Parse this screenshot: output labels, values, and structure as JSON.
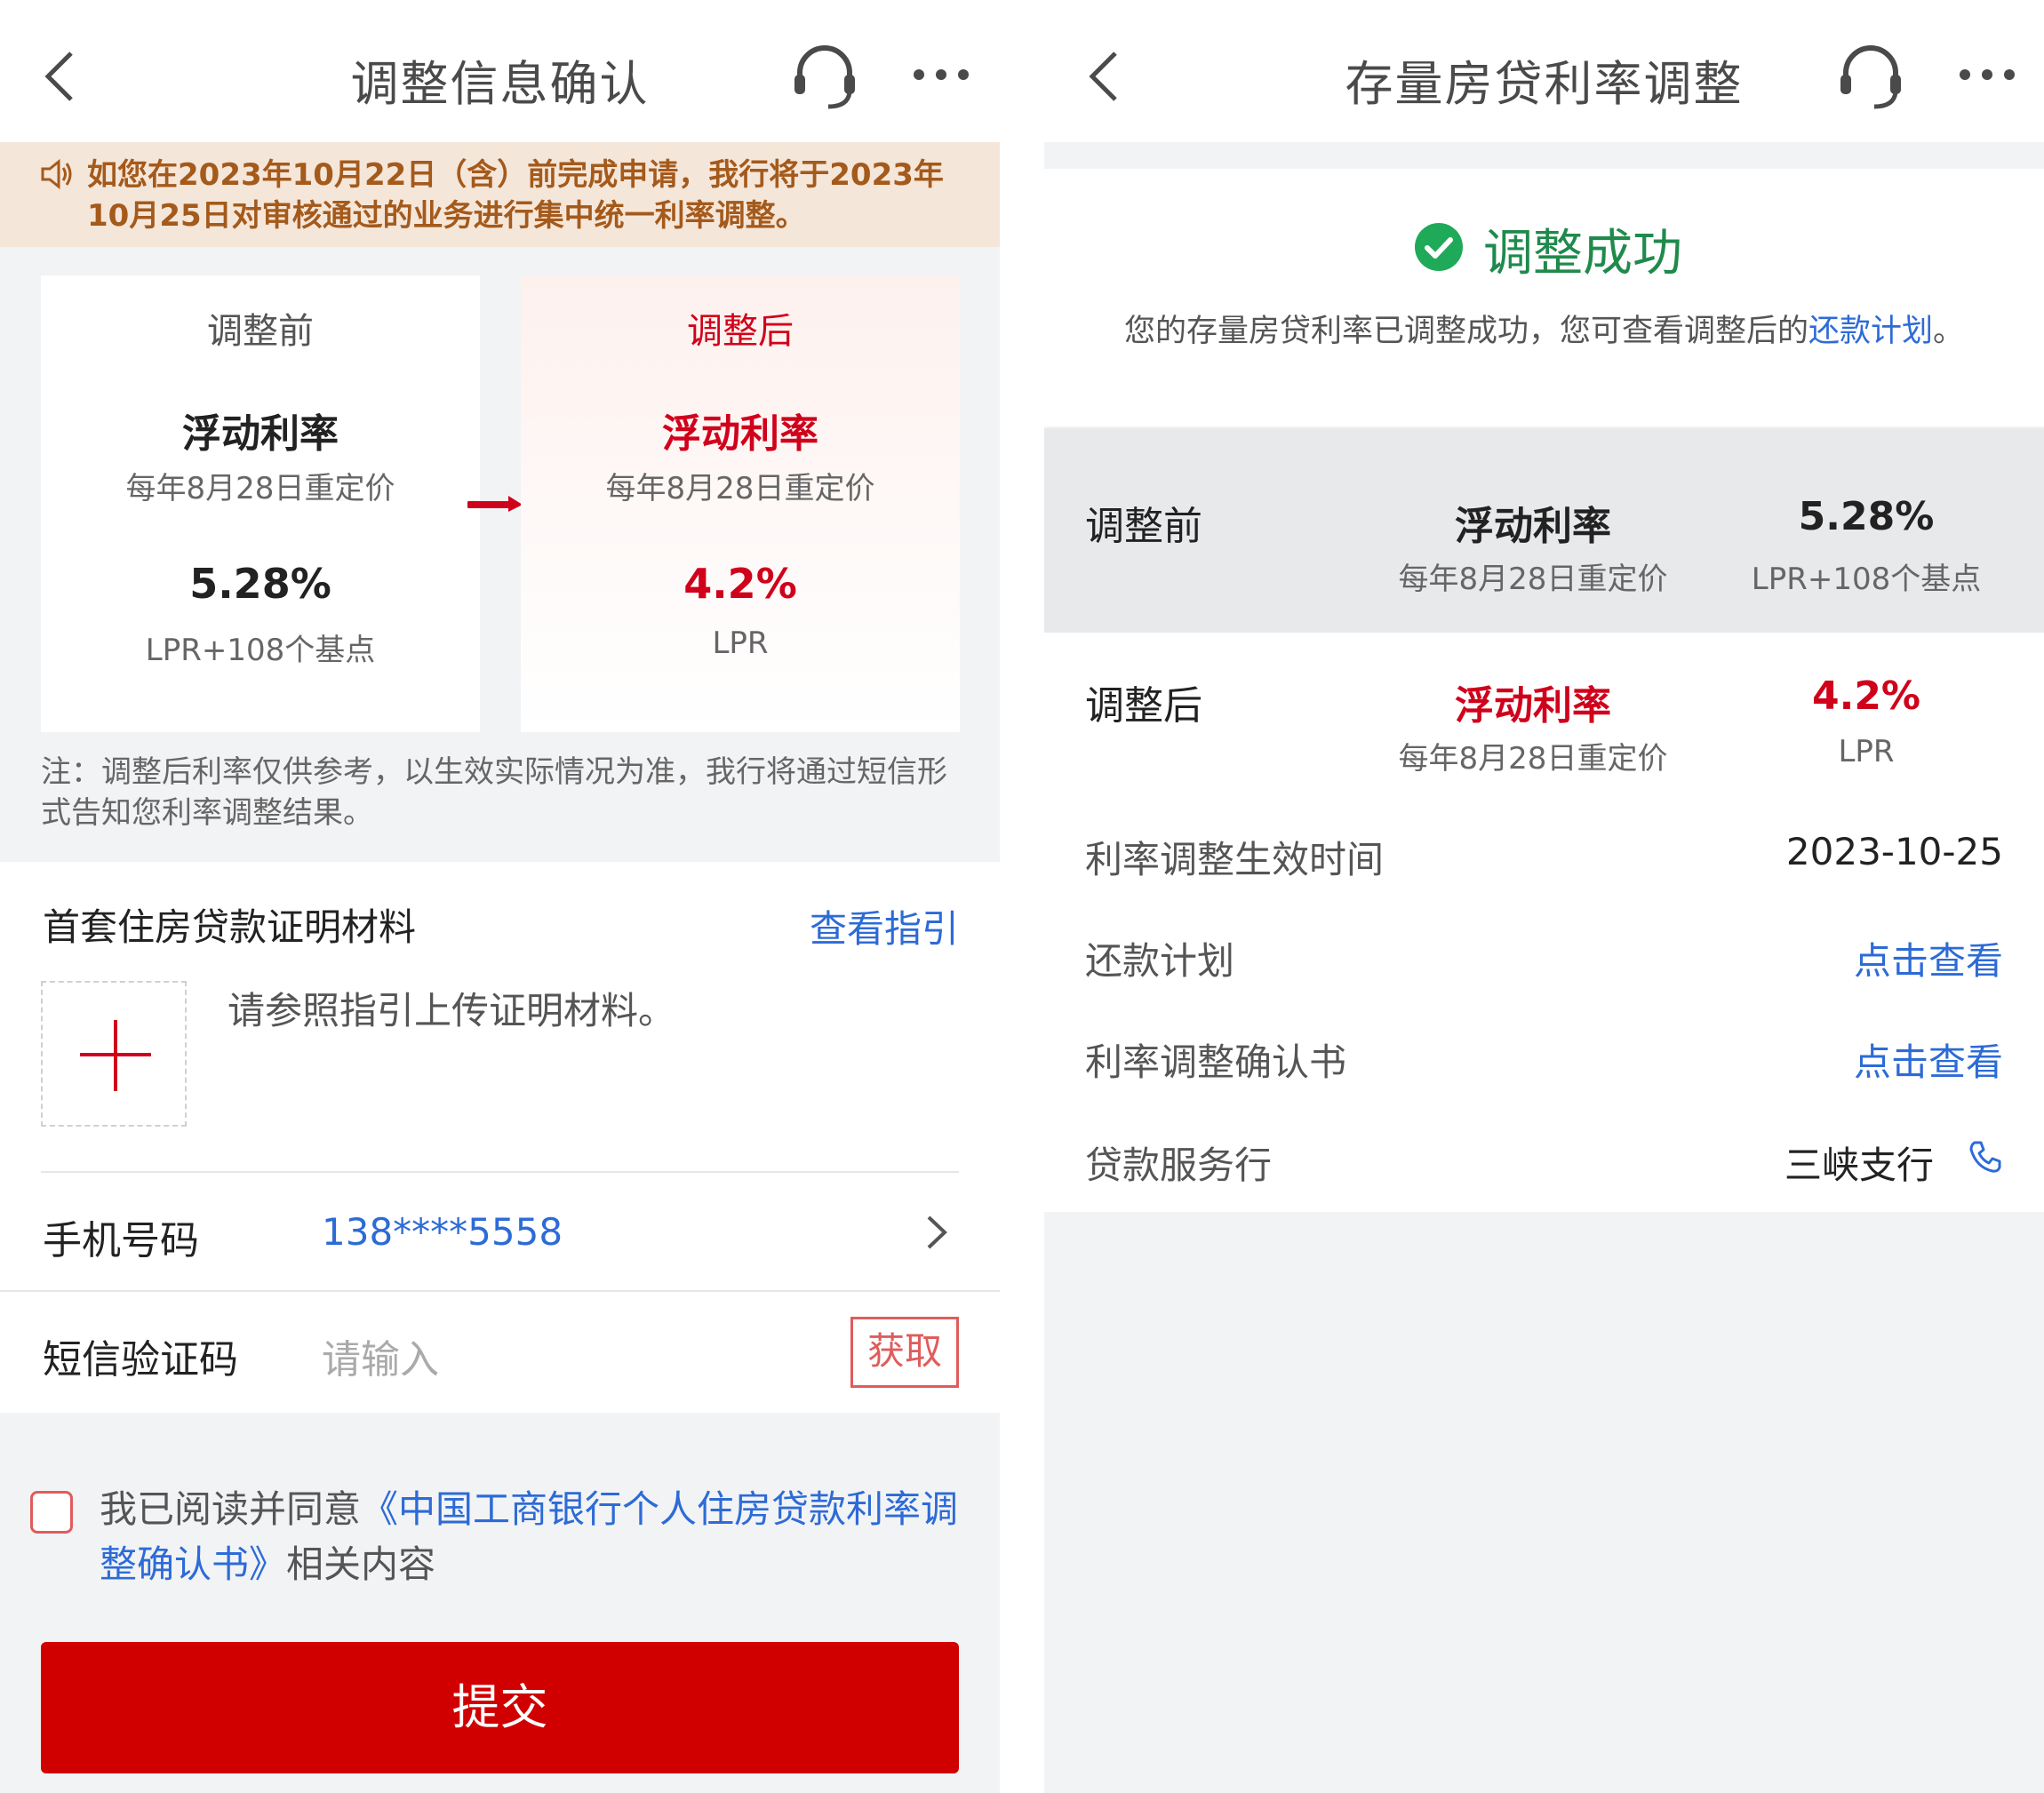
{
  "left": {
    "nav": {
      "title": "调整信息确认"
    },
    "notice": "如您在2023年10月22日（含）前完成申请，我行将于2023年10月25日对审核通过的业务进行集中统一利率调整。",
    "before": {
      "title": "调整前",
      "type": "浮动利率",
      "repricing": "每年8月28日重定价",
      "rate": "5.28%",
      "rate_desc": "LPR+108个基点"
    },
    "after": {
      "title": "调整后",
      "type": "浮动利率",
      "repricing": "每年8月28日重定价",
      "rate": "4.2%",
      "rate_desc": "LPR"
    },
    "note": "注：调整后利率仅供参考，以生效实际情况为准，我行将通过短信形式告知您利率调整结果。",
    "section_title": "首套住房贷款证明材料",
    "guide_link": "查看指引",
    "upload_hint": "请参照指引上传证明材料。",
    "phone_label": "手机号码",
    "phone_value": "138****5558",
    "sms_label": "短信验证码",
    "sms_placeholder": "请输入",
    "get_code": "获取",
    "agree_prefix": "我已阅读并同意",
    "agree_link": "《中国工商银行个人住房贷款利率调整确认书》",
    "agree_suffix": "相关内容",
    "submit": "提交"
  },
  "right": {
    "nav": {
      "title": "存量房贷利率调整"
    },
    "status_title": "调整成功",
    "status_desc_prefix": "您的存量房贷利率已调整成功，您可查看调整后的",
    "status_desc_link": "还款计划",
    "status_desc_suffix": "。",
    "before": {
      "label": "调整前",
      "type": "浮动利率",
      "repricing": "每年8月28日重定价",
      "rate": "5.28%",
      "rate_desc": "LPR+108个基点"
    },
    "after": {
      "label": "调整后",
      "type": "浮动利率",
      "repricing": "每年8月28日重定价",
      "rate": "4.2%",
      "rate_desc": "LPR"
    },
    "effective_label": "利率调整生效时间",
    "effective_value": "2023-10-25",
    "plan_label": "还款计划",
    "plan_link": "点击查看",
    "confirm_label": "利率调整确认书",
    "confirm_link": "点击查看",
    "branch_label": "贷款服务行",
    "branch_value": "三峡支行"
  },
  "colors": {
    "accent_red": "#d0021b",
    "link_blue": "#2d6bd6",
    "success_green": "#1f8a4c",
    "notice_bg": "#f5e6da",
    "notice_text": "#a45a1b"
  },
  "icons": [
    "back-icon",
    "headset-icon",
    "more-icon",
    "speaker-icon",
    "arrow-right-icon",
    "plus-icon",
    "chevron-right-icon",
    "checkbox-icon",
    "check-circle-icon",
    "phone-icon"
  ]
}
